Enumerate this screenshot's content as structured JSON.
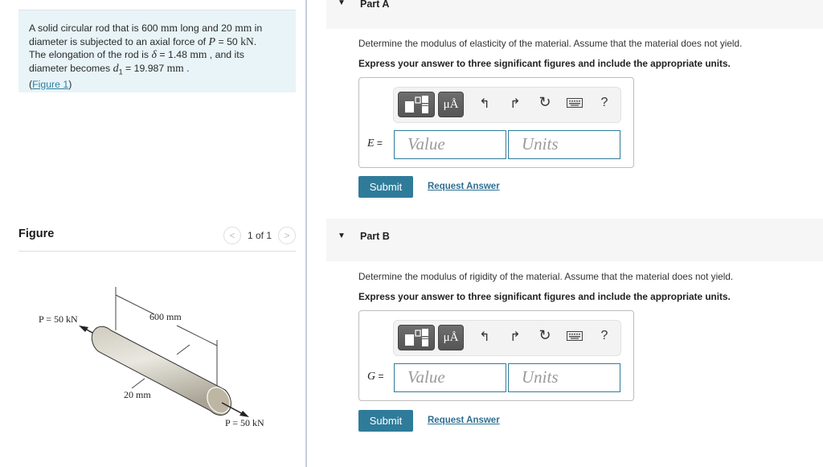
{
  "problem": {
    "line1_a": "A solid circular rod that is 600 ",
    "unit_mm": "mm",
    "line1_b": " long and 20 ",
    "line1_c": " in",
    "line2_a": "diameter is subjected to an axial force of ",
    "P_symbol": "P",
    "line2_b": " = 50 ",
    "kN": "kN",
    "period": ".",
    "line3_a": "The elongation of the rod is ",
    "delta_symbol": "δ",
    "line3_b": " = 1.48  ",
    "line3_c": " , and its",
    "line4_a": "diameter becomes ",
    "d1_symbol": "d",
    "d1_sub": "1",
    "line4_b": " = 19.987  ",
    "line4_c": " .",
    "figure_link_open": "(",
    "figure_link": "Figure 1",
    "figure_link_close": ")"
  },
  "figure": {
    "title": "Figure",
    "pager": {
      "prev_icon": "chevron-left-icon",
      "next_icon": "chevron-right-icon",
      "count": "1 of 1"
    },
    "labels": {
      "force_left": "P = 50 kN",
      "length": "600 mm",
      "diameter": "20 mm",
      "force_right": "P = 50 kN"
    }
  },
  "parts": [
    {
      "label": "Part A",
      "question": "Determine the modulus of elasticity of the material. Assume that the material does not yield.",
      "instruction": "Express your answer to three significant figures and include the appropriate units.",
      "variable": "E",
      "eq": " =",
      "value_placeholder": "Value",
      "units_placeholder": "Units",
      "submit": "Submit",
      "request": "Request Answer"
    },
    {
      "label": "Part B",
      "question": "Determine the modulus of rigidity of the material. Assume that the material does not yield.",
      "instruction": "Express your answer to three significant figures and include the appropriate units.",
      "variable": "G",
      "eq": " =",
      "value_placeholder": "Value",
      "units_placeholder": "Units",
      "submit": "Submit",
      "request": "Request Answer"
    }
  ],
  "toolbar": {
    "templates_icon": "templates-icon",
    "units_button": "μÅ",
    "undo_icon": "↰",
    "redo_icon": "↱",
    "reset_icon": "↻",
    "keyboard_icon": "keyboard-icon",
    "help": "?"
  },
  "colors": {
    "accent": "#2f7b9a",
    "link": "#2e7fa2",
    "problem_bg": "#e8f4f7",
    "part_header_bg": "#f6f6f6"
  }
}
